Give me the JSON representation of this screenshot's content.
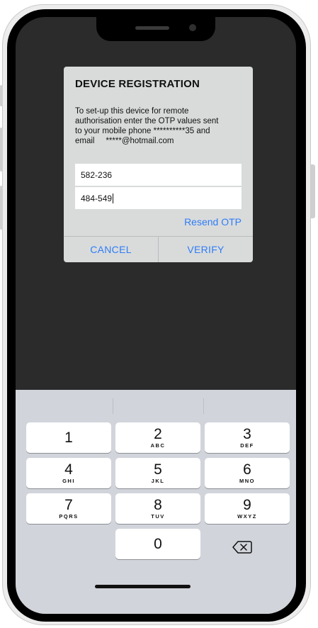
{
  "dialog": {
    "title": "DEVICE REGISTRATION",
    "message_line1": "To set-up this device for remote",
    "message_line2": "authorisation enter the OTP values sent",
    "message_line3": "to your mobile phone **********35 and",
    "message_line4": "email     *****@hotmail.com",
    "otp1_value": "582-236",
    "otp2_value": "484-549",
    "resend_label": "Resend OTP",
    "cancel_label": "CANCEL",
    "verify_label": "VERIFY"
  },
  "keyboard": {
    "keys": [
      {
        "digit": "1",
        "letters": ""
      },
      {
        "digit": "2",
        "letters": "ABC"
      },
      {
        "digit": "3",
        "letters": "DEF"
      },
      {
        "digit": "4",
        "letters": "GHI"
      },
      {
        "digit": "5",
        "letters": "JKL"
      },
      {
        "digit": "6",
        "letters": "MNO"
      },
      {
        "digit": "7",
        "letters": "PQRS"
      },
      {
        "digit": "8",
        "letters": "TUV"
      },
      {
        "digit": "9",
        "letters": "WXYZ"
      },
      {
        "digit": "0",
        "letters": ""
      }
    ],
    "backspace_icon": "backspace-icon"
  },
  "colors": {
    "accent": "#2f7df6",
    "dialog_bg": "#d9dbdb",
    "screen_bg": "#2b2b2b",
    "keyboard_bg": "#d1d4da"
  }
}
